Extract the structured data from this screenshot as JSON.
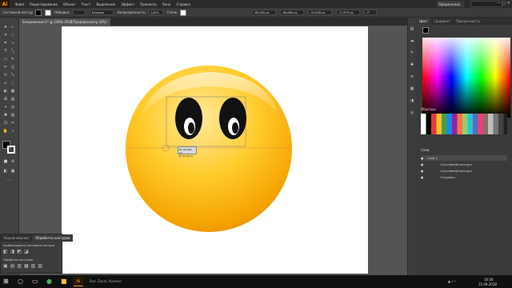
{
  "app": {
    "logo": "Ai"
  },
  "menu": [
    "Файл",
    "Редактирование",
    "Объект",
    "Текст",
    "Выделение",
    "Эффект",
    "Просмотр",
    "Окно",
    "Справка"
  ],
  "workspace": "Оформление",
  "control": {
    "selection_label": "Составной контур",
    "stroke_label": "Обводка:",
    "stroke_value": "",
    "brush_value": "Базовая",
    "opacity_label": "Непрозрачность:",
    "opacity_value": "100%",
    "style_label": "Стиль:",
    "w_value": "86,065 px",
    "h_value": "66,668 px",
    "x_value": "90,838 px",
    "y_value": "27,879 px",
    "angle_value": "0°"
  },
  "document_tab": "Безымянный-1* @ 100% (RGB/Предпросмотр GPU)",
  "color_panel": {
    "tabs": [
      "Цвет",
      "Градиент",
      "Прозрачность"
    ]
  },
  "swatches_panel": {
    "title": "Образцы"
  },
  "layers_panel": {
    "title": "Слои",
    "rows": [
      "Слой 1",
      "<Составной контур>",
      "<Составной контур>",
      "<Группа>"
    ]
  },
  "float_panel": {
    "tabs": [
      "Выравнивание",
      "Обработка контуров"
    ],
    "section1": "Комбинировать составные контуры",
    "section2": "Обработка контуров"
  },
  "measure": {
    "line1": "Ш: 86,065 px",
    "line2": "В: 57,49 px"
  },
  "taskbar": {
    "search": "Все, Zoom, Кнопки",
    "time": "10:56",
    "date": "15.09.2018"
  },
  "colors": {
    "accent": "#ff9a00",
    "face_top": "#ffe08a",
    "face_bottom": "#f2a100",
    "eye": "#111111"
  }
}
